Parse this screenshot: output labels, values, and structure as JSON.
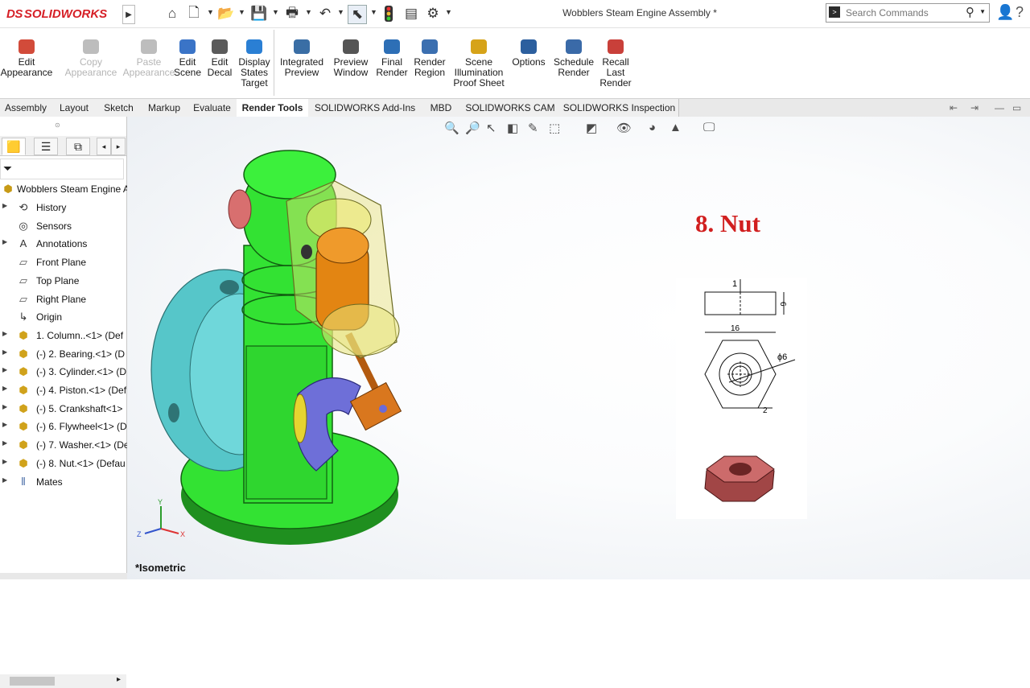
{
  "app": {
    "brand_ds": "DS",
    "brand_name": "SOLIDWORKS",
    "doc_title": "Wobblers Steam Engine Assembly *"
  },
  "search": {
    "placeholder": "Search Commands"
  },
  "quick_access": [
    "home-icon",
    "new-document-icon",
    "open-icon",
    "save-icon",
    "print-icon",
    "undo-icon",
    "select-arrow-icon",
    "traffic-light-icon",
    "file-properties-icon",
    "options-gear-icon"
  ],
  "ribbon": {
    "buttons": [
      {
        "label": "Edit\nAppearance",
        "enabled": true,
        "color": "#d24b3a"
      },
      {
        "label": "Copy\nAppearance",
        "enabled": false,
        "color": "#bdbdbd"
      },
      {
        "label": "Paste\nAppearance",
        "enabled": false,
        "color": "#bdbdbd"
      },
      {
        "label": "Edit\nScene",
        "enabled": true,
        "color": "#3a74c7"
      },
      {
        "label": "Edit\nDecal",
        "enabled": true,
        "color": "#5b5b5b"
      },
      {
        "label": "Display\nStates\nTarget",
        "enabled": true,
        "color": "#2a7fd4"
      },
      {
        "label": "Integrated\nPreview",
        "enabled": true,
        "color": "#3a6ea5"
      },
      {
        "label": "Preview\nWindow",
        "enabled": true,
        "color": "#555"
      },
      {
        "label": "Final\nRender",
        "enabled": true,
        "color": "#2d6fb6"
      },
      {
        "label": "Render\nRegion",
        "enabled": true,
        "color": "#3b6fb0"
      },
      {
        "label": "Scene\nIllumination\nProof Sheet",
        "enabled": true,
        "color": "#d6a319"
      },
      {
        "label": "Options",
        "enabled": true,
        "color": "#2c5f9e"
      },
      {
        "label": "Schedule\nRender",
        "enabled": true,
        "color": "#3a6aa8"
      },
      {
        "label": "Recall\nLast\nRender",
        "enabled": true,
        "color": "#c9403a"
      }
    ]
  },
  "tabs": [
    {
      "label": "Assembly",
      "active": false
    },
    {
      "label": "Layout",
      "active": false
    },
    {
      "label": "Sketch",
      "active": false
    },
    {
      "label": "Markup",
      "active": false
    },
    {
      "label": "Evaluate",
      "active": false
    },
    {
      "label": "Render Tools",
      "active": true
    },
    {
      "label": "SOLIDWORKS Add-Ins",
      "active": false
    },
    {
      "label": "MBD",
      "active": false
    },
    {
      "label": "SOLIDWORKS CAM",
      "active": false
    },
    {
      "label": "SOLIDWORKS Inspection",
      "active": false
    }
  ],
  "feature_tree": {
    "root": "Wobblers Steam Engine A",
    "items": [
      {
        "label": "History",
        "icon": "history-icon",
        "expandable": true
      },
      {
        "label": "Sensors",
        "icon": "sensors-icon",
        "expandable": false
      },
      {
        "label": "Annotations",
        "icon": "annotations-icon",
        "expandable": true
      },
      {
        "label": "Front Plane",
        "icon": "plane-icon",
        "expandable": false
      },
      {
        "label": "Top Plane",
        "icon": "plane-icon",
        "expandable": false
      },
      {
        "label": "Right Plane",
        "icon": "plane-icon",
        "expandable": false
      },
      {
        "label": "Origin",
        "icon": "origin-icon",
        "expandable": false
      },
      {
        "label": "1. Column..<1> (Def",
        "icon": "part-icon",
        "expandable": true
      },
      {
        "label": "(-) 2. Bearing.<1> (D",
        "icon": "part-icon",
        "expandable": true
      },
      {
        "label": "(-) 3. Cylinder.<1> (D",
        "icon": "part-icon",
        "expandable": true
      },
      {
        "label": "(-) 4. Piston.<1> (Def",
        "icon": "part-icon",
        "expandable": true
      },
      {
        "label": "(-) 5. Crankshaft<1>",
        "icon": "part-icon",
        "expandable": true
      },
      {
        "label": "(-) 6. Flywheel<1> (D",
        "icon": "part-icon",
        "expandable": true
      },
      {
        "label": "(-) 7. Washer.<1> (De",
        "icon": "part-icon",
        "expandable": true
      },
      {
        "label": "(-) 8. Nut.<1> (Defau",
        "icon": "part-icon",
        "expandable": true
      },
      {
        "label": "Mates",
        "icon": "mates-icon",
        "expandable": true
      }
    ]
  },
  "viewport": {
    "view_label": "*Isometric",
    "annotation_title": "8. Nut",
    "axes": {
      "x": "X",
      "y": "Y",
      "z": "Z"
    },
    "drawing": {
      "dim_top": "1",
      "dim_height": "6",
      "dim_width": "16",
      "dim_diameter": "ϕ6",
      "dim_chamfer": "2"
    }
  }
}
